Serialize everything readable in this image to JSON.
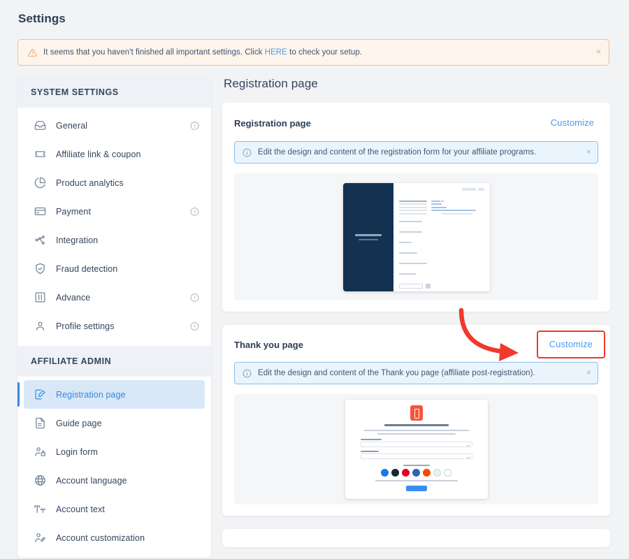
{
  "page": {
    "heading": "Settings",
    "main_title": "Registration page"
  },
  "alert": {
    "icon": "warning-triangle-icon",
    "text_before": "It seems that you haven't finished all important settings. Click ",
    "link": "HERE",
    "text_after": " to check your setup.",
    "close": "×",
    "bg_color": "#fdf4ec",
    "border_color": "#f2bf8f",
    "link_color": "#4a9bf0"
  },
  "sidebar": {
    "groups": [
      {
        "title": "SYSTEM SETTINGS",
        "items": [
          {
            "label": "General",
            "icon": "inbox-tray-icon",
            "has_info": true,
            "active": false
          },
          {
            "label": "Affiliate link & coupon",
            "icon": "ticket-icon",
            "has_info": false,
            "active": false
          },
          {
            "label": "Product analytics",
            "icon": "pie-chart-icon",
            "has_info": false,
            "active": false
          },
          {
            "label": "Payment",
            "icon": "credit-card-icon",
            "has_info": true,
            "active": false
          },
          {
            "label": "Integration",
            "icon": "network-nodes-icon",
            "has_info": false,
            "active": false
          },
          {
            "label": "Fraud detection",
            "icon": "shield-check-icon",
            "has_info": false,
            "active": false
          },
          {
            "label": "Advance",
            "icon": "sliders-icon",
            "has_info": true,
            "active": false
          },
          {
            "label": "Profile settings",
            "icon": "user-icon",
            "has_info": true,
            "active": false
          }
        ]
      },
      {
        "title": "AFFILIATE ADMIN",
        "items": [
          {
            "label": "Registration page",
            "icon": "page-edit-icon",
            "has_info": false,
            "active": true
          },
          {
            "label": "Guide page",
            "icon": "document-icon",
            "has_info": false,
            "active": false
          },
          {
            "label": "Login form",
            "icon": "user-lock-icon",
            "has_info": false,
            "active": false
          },
          {
            "label": "Account language",
            "icon": "globe-icon",
            "has_info": false,
            "active": false
          },
          {
            "label": "Account text",
            "icon": "text-size-icon",
            "has_info": false,
            "active": false
          },
          {
            "label": "Account customization",
            "icon": "user-edit-icon",
            "has_info": false,
            "active": false
          }
        ]
      }
    ],
    "active_color": "#3b87d8",
    "active_bg": "#d8e8f8",
    "group_header_bg": "#eef1f6"
  },
  "cards": [
    {
      "title": "Registration page",
      "customize_label": "Customize",
      "highlighted": false,
      "info": {
        "icon": "info-circle-icon",
        "text": "Edit the design and content of the registration form for your affiliate programs.",
        "close": "×"
      },
      "preview": "registration-form-thumbnail"
    },
    {
      "title": "Thank you page",
      "customize_label": "Customize",
      "highlighted": true,
      "info": {
        "icon": "info-circle-icon",
        "text": "Edit the design and content of the Thank you page (affiliate post-registration).",
        "close": "×"
      },
      "preview": "thank-you-page-thumbnail"
    }
  ],
  "annotation": {
    "type": "curved-arrow",
    "color": "#f0392b",
    "points_to": "thank-you-customize-button",
    "highlight_box_color": "#f0392b"
  },
  "thumbnails": {
    "registration": {
      "panel_color": "#133251",
      "submit_button_color": "#21c6b5",
      "logo_color": "#f4563b"
    },
    "thank_you": {
      "logo_color": "#f4563b",
      "button_color": "#3b8ef0",
      "social_icons": [
        {
          "name": "facebook-icon",
          "color": "#1877f2"
        },
        {
          "name": "twitter-icon",
          "color": "#1b2733"
        },
        {
          "name": "pinterest-icon",
          "color": "#e60023"
        },
        {
          "name": "linkedin-icon",
          "color": "#2867b2"
        },
        {
          "name": "reddit-icon",
          "color": "#ff4500"
        },
        {
          "name": "whatsapp-icon",
          "color": "#e8f5ea"
        },
        {
          "name": "email-icon",
          "color": "#ffffff"
        }
      ]
    }
  }
}
